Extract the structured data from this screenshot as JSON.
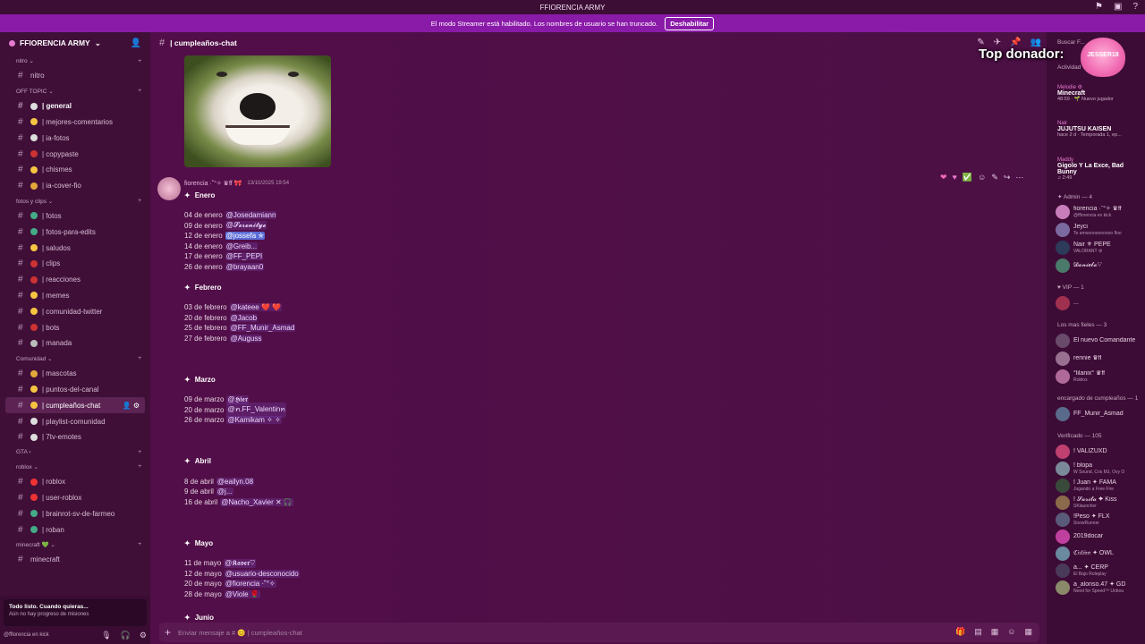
{
  "window": {
    "title": "FFIORENCIA ARMY"
  },
  "banner": {
    "text": "El modo Streamer está habilitado. Los nombres de usuario se han truncado.",
    "button": "Deshabilitar"
  },
  "server": {
    "name": "FFIORENCIA ARMY"
  },
  "sidebar": {
    "sections": [
      {
        "type": "cat",
        "label": "nitro ⌄"
      },
      {
        "type": "ch",
        "label": "nitro"
      },
      {
        "type": "cat",
        "label": "OFF TOPIC ⌄"
      },
      {
        "type": "ch",
        "label": "| general",
        "bold": true,
        "emo": "#ddd"
      },
      {
        "type": "ch",
        "label": "| mejores-comentarios",
        "emo": "#f5c542"
      },
      {
        "type": "ch",
        "label": "| ia-fotos",
        "emo": "#ddd"
      },
      {
        "type": "ch",
        "label": "| copypaste",
        "emo": "#c33"
      },
      {
        "type": "ch",
        "label": "| chismes",
        "emo": "#f5c542"
      },
      {
        "type": "ch",
        "label": "| ia-cover-fio",
        "emo": "#e3a63a"
      },
      {
        "type": "cat",
        "label": "fotos y clips ⌄"
      },
      {
        "type": "ch",
        "label": "| fotos",
        "emo": "#4a8"
      },
      {
        "type": "ch",
        "label": "| fotos-para-edits",
        "emo": "#4a8"
      },
      {
        "type": "ch",
        "label": "| saludos",
        "emo": "#f5c542"
      },
      {
        "type": "ch",
        "label": "| clips",
        "emo": "#c33"
      },
      {
        "type": "ch",
        "label": "| reacciones",
        "emo": "#c33"
      },
      {
        "type": "ch",
        "label": "| memes",
        "emo": "#f5c542"
      },
      {
        "type": "ch",
        "label": "| comunidad-twitter",
        "emo": "#f5c542"
      },
      {
        "type": "ch",
        "label": "| bots",
        "emo": "#c33"
      },
      {
        "type": "ch",
        "label": "| manada",
        "emo": "#bbb"
      },
      {
        "type": "cat",
        "label": "Comunidad ⌄"
      },
      {
        "type": "ch",
        "label": "| mascotas",
        "emo": "#e3a63a"
      },
      {
        "type": "ch",
        "label": "| puntos-del-canal",
        "emo": "#f5c542"
      },
      {
        "type": "ch",
        "label": "| cumpleaños-chat",
        "active": true,
        "emo": "#f5c542"
      },
      {
        "type": "ch",
        "label": "| playlist-comunidad",
        "emo": "#ddd"
      },
      {
        "type": "ch",
        "label": "| 7tv-emotes",
        "emo": "#ddd"
      },
      {
        "type": "cat",
        "label": "GTA ›"
      },
      {
        "type": "cat",
        "label": "roblox ⌄"
      },
      {
        "type": "ch",
        "label": "| roblox",
        "emo": "#e33"
      },
      {
        "type": "ch",
        "label": "| user-roblox",
        "emo": "#e33"
      },
      {
        "type": "ch",
        "label": "| brainrot-sv-de-farmeo",
        "emo": "#4a8"
      },
      {
        "type": "ch",
        "label": "| roban",
        "emo": "#4a8"
      },
      {
        "type": "cat",
        "label": "minecraft 💚 ⌄"
      },
      {
        "type": "ch",
        "label": "minecraft"
      }
    ],
    "mission": {
      "title": "Todo listo. Cuando quieras...",
      "sub": "Aún no hay progreso de misiones"
    },
    "user": "@fflorencia en kick"
  },
  "channel": {
    "name": "| cumpleaños-chat"
  },
  "message": {
    "author": "fiorencia ·˚°✧ ♛ff 🎀",
    "timestamp": "13/10/2025 19:54",
    "months": [
      {
        "title": "Enero",
        "lines": [
          [
            "04 de enero",
            "@Josedamiann"
          ],
          [
            "09 de enero",
            "@𝓢𝓮𝓻𝓮𝓷𝓲𝓽𝔂𝓮"
          ],
          [
            "12 de enero",
            "@jossefa ✯"
          ],
          [
            "14 de enero",
            "@Greib..."
          ],
          [
            "17 de enero",
            "@FF_PEPI"
          ],
          [
            "26 de enero",
            "@brayaan0"
          ]
        ]
      },
      {
        "title": "Febrero",
        "lines": [
          [
            "03 de febrero",
            "@kateee ❤️ ❤️"
          ],
          [
            "20 de febrero",
            "@Jacob"
          ],
          [
            "25 de febrero",
            "@FF_Munir_Asmad"
          ],
          [
            "27 de febrero",
            "@Auguss"
          ]
        ]
      },
      {
        "title": "Marzo",
        "lines": [
          [
            "09 de marzo",
            "@𝕳𝖎𝖊𝖗"
          ],
          [
            "20 de marzo",
            "@ꪀ.FF_Valentinꪀ"
          ],
          [
            "26 de marzo",
            "@Kamikam ✧ ✧"
          ]
        ]
      },
      {
        "title": "Abril",
        "lines": [
          [
            "8 de abril",
            "@eailyn.08"
          ],
          [
            "9 de abril",
            "@j..."
          ],
          [
            "16 de abril",
            "@Nacho_Xavier ✕ 🎧"
          ]
        ]
      },
      {
        "title": "Mayo",
        "lines": [
          [
            "11 de mayo",
            "@𝕶𝖆𝖛𝖊𝖗♡"
          ],
          [
            "12 de mayo",
            "@usuario-desconocido"
          ],
          [
            "20 de mayo",
            "@fiorencia ·˚°✧"
          ],
          [
            "28 de mayo",
            "@Viole 🌹"
          ]
        ]
      },
      {
        "title": "Junio",
        "lines": []
      }
    ]
  },
  "composer": {
    "placeholder": "Enviar mensaje a # 😊 | cumpleaños-chat"
  },
  "overlay": {
    "top_donor": "Top donador:",
    "donor_name": "JESSER18"
  },
  "members": {
    "search": "Buscar F...",
    "activity_label": "Actividad",
    "activity": [
      {
        "a1": "Melodie ⚙",
        "a2": "Minecraft",
        "a3": "48:59 · 🌱 Nuevo jugador"
      },
      {
        "a1": "Nair",
        "a2": "JUJUTSU KAISEN",
        "a3": "hace 2 d · Temporada 1, ep..."
      },
      {
        "a1": "Maddy",
        "a2": "Gigolo Y La Exce, Bad Bunny",
        "a3": "♫ 2:49"
      }
    ],
    "groups": [
      {
        "label": "✦ Admin — 4",
        "items": [
          [
            "fiorencia ·˚°✧ ♛ff",
            "@fflorencia en kick"
          ],
          [
            "Jeyci",
            "Te amooooooooooo floo"
          ],
          [
            "Nair ⚜ PEPE",
            "VALORANT ⚙"
          ],
          [
            "𝓓𝓪𝓷𝓲𝓮𝓵𝓪♡",
            ""
          ]
        ]
      },
      {
        "label": "♥ VIP — 1",
        "items": [
          [
            "...",
            ""
          ]
        ]
      },
      {
        "label": "Los mas fieles — 3",
        "items": [
          [
            "El nuevo Comandante",
            ""
          ],
          [
            "rennie ♛ff",
            ""
          ],
          [
            "°lilanix° ♛ff",
            "Roblox"
          ]
        ]
      },
      {
        "label": "encargado de cumpleaños — 1",
        "items": [
          [
            "FF_Munir_Asmad",
            ""
          ]
        ]
      },
      {
        "label": "Verificado — 105",
        "items": [
          [
            "! VALIZUXD",
            ""
          ],
          [
            "! blopa",
            "W Sound, Cris MJ, Ovy O"
          ],
          [
            "! Juan ✦ FAMA",
            "Jugando a Free Fire"
          ],
          [
            "! 𝓢𝓪𝓻𝓲𝓽𝓪 ✦ Kiss",
            "SKlauncher"
          ],
          [
            "!Peso ✦ FLX",
            "SnowRunner"
          ],
          [
            "2019docar",
            ""
          ],
          [
            "ℭ𝔦𝔠𝔥𝔦𝔪 ✦ OWL",
            ""
          ],
          [
            "a... ✦ CERP",
            "El Bajo Roleplay"
          ],
          [
            "a_alonso.47 ✦ GD",
            "Need for Speed™ Unbou"
          ]
        ]
      }
    ]
  },
  "colors": {
    "banner": "#8a1aa8",
    "sidebar": "#3f0f38",
    "main": "#520e48",
    "mention_highlight": "#5a6cd6"
  }
}
